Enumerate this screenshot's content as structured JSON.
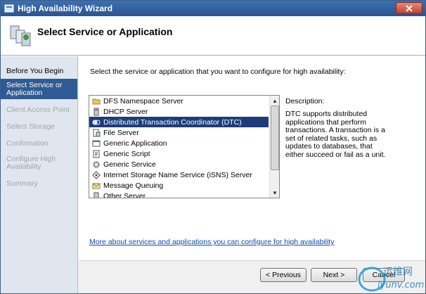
{
  "window": {
    "title": "High Availability Wizard"
  },
  "header": {
    "title": "Select Service or Application"
  },
  "steps": [
    {
      "label": "Before You Begin",
      "state": "done"
    },
    {
      "label": "Select Service or Application",
      "state": "active"
    },
    {
      "label": "Client Access Point",
      "state": "disabled"
    },
    {
      "label": "Select Storage",
      "state": "disabled"
    },
    {
      "label": "Confirmation",
      "state": "disabled"
    },
    {
      "label": "Configure High Availability",
      "state": "disabled"
    },
    {
      "label": "Summary",
      "state": "disabled"
    }
  ],
  "main": {
    "instruction": "Select the service or application that you want to configure for high availability:",
    "services": [
      {
        "label": "DFS Namespace Server",
        "icon": "folder-icon"
      },
      {
        "label": "DHCP Server",
        "icon": "server-icon"
      },
      {
        "label": "Distributed Transaction Coordinator (DTC)",
        "icon": "dtc-icon",
        "selected": true
      },
      {
        "label": "File Server",
        "icon": "file-server-icon"
      },
      {
        "label": "Generic Application",
        "icon": "application-icon"
      },
      {
        "label": "Generic Script",
        "icon": "script-icon"
      },
      {
        "label": "Generic Service",
        "icon": "service-gear-icon"
      },
      {
        "label": "Internet Storage Name Service (iSNS) Server",
        "icon": "isns-icon"
      },
      {
        "label": "Message Queuing",
        "icon": "message-queue-icon"
      },
      {
        "label": "Other Server",
        "icon": "server-icon"
      }
    ],
    "description_label": "Description:",
    "description_text": "DTC supports distributed applications that perform transactions. A transaction is a set of related tasks, such as updates to databases, that either succeed or fail as a unit.",
    "more_link": "More about services and applications you can configure for high availability"
  },
  "footer": {
    "previous_label": "< Previous",
    "next_label": "Next >",
    "cancel_label": "Cancel"
  },
  "watermark": {
    "text_cn": "运维网",
    "text_url": "iyunv.com"
  },
  "colors": {
    "selection": "#1c3d7a",
    "active_step": "#2f5b94",
    "link": "#0b4ea8"
  }
}
